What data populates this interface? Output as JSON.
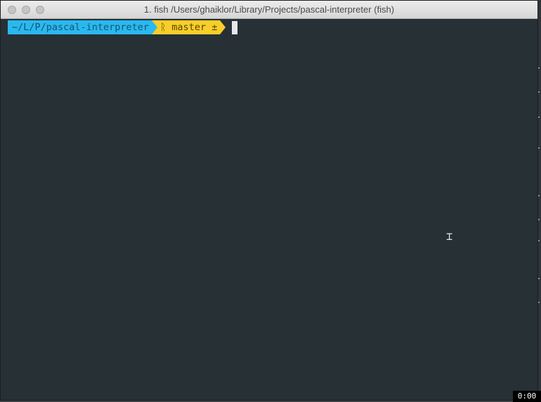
{
  "window": {
    "title": "1. fish  /Users/ghaiklor/Library/Projects/pascal-interpreter (fish)"
  },
  "prompt": {
    "path": "~/L/P/pascal-interpreter",
    "git_branch": "ᚱ master ±",
    "path_color": "#29b9f0",
    "git_color": "#f8ce2a"
  },
  "terminal": {
    "background": "#263035",
    "pointer": "⌶"
  },
  "recording": {
    "timer": "0:00"
  }
}
